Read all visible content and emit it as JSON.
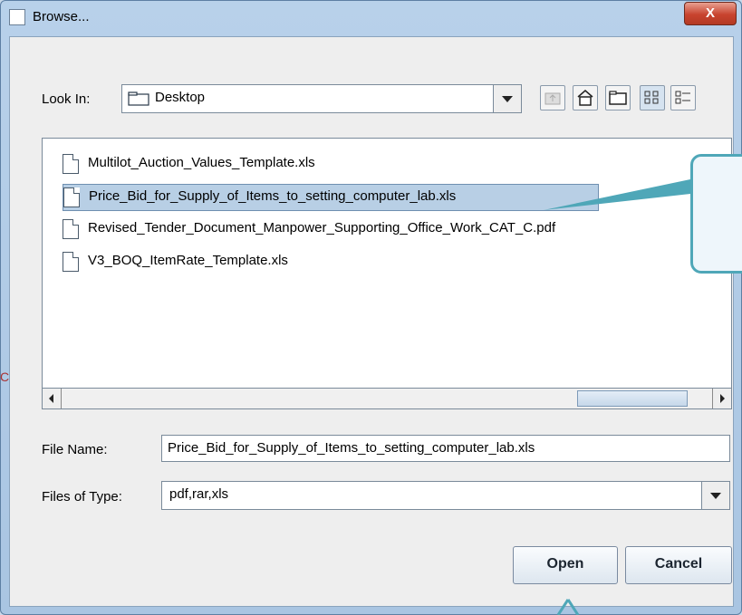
{
  "window": {
    "title": "Browse...",
    "close_label": "X"
  },
  "look_in": {
    "label": "Look In:",
    "value": "Desktop"
  },
  "toolbar": {
    "icons": [
      "up-folder-icon",
      "home-icon",
      "new-folder-icon",
      "list-view-icon",
      "details-view-icon"
    ]
  },
  "files": [
    {
      "name": "Multilot_Auction_Values_Template.xls"
    },
    {
      "name": "Price_Bid_for_Supply_of_Items_to_setting_computer_lab.xls",
      "selected": true
    },
    {
      "name": "Revised_Tender_Document_Manpower_Supporting_Office_Work_CAT_C.pdf"
    },
    {
      "name": "V3_BOQ_ItemRate_Template.xls"
    }
  ],
  "file_name": {
    "label": "File Name:",
    "value": "Price_Bid_for_Supply_of_Items_to_setting_computer_lab.xls"
  },
  "file_type": {
    "label": "Files of Type:",
    "value": "pdf,rar,xls"
  },
  "buttons": {
    "open": "Open",
    "cancel": "Cancel"
  },
  "colors": {
    "accent": "#4fa7b8",
    "close": "#c8432e"
  }
}
